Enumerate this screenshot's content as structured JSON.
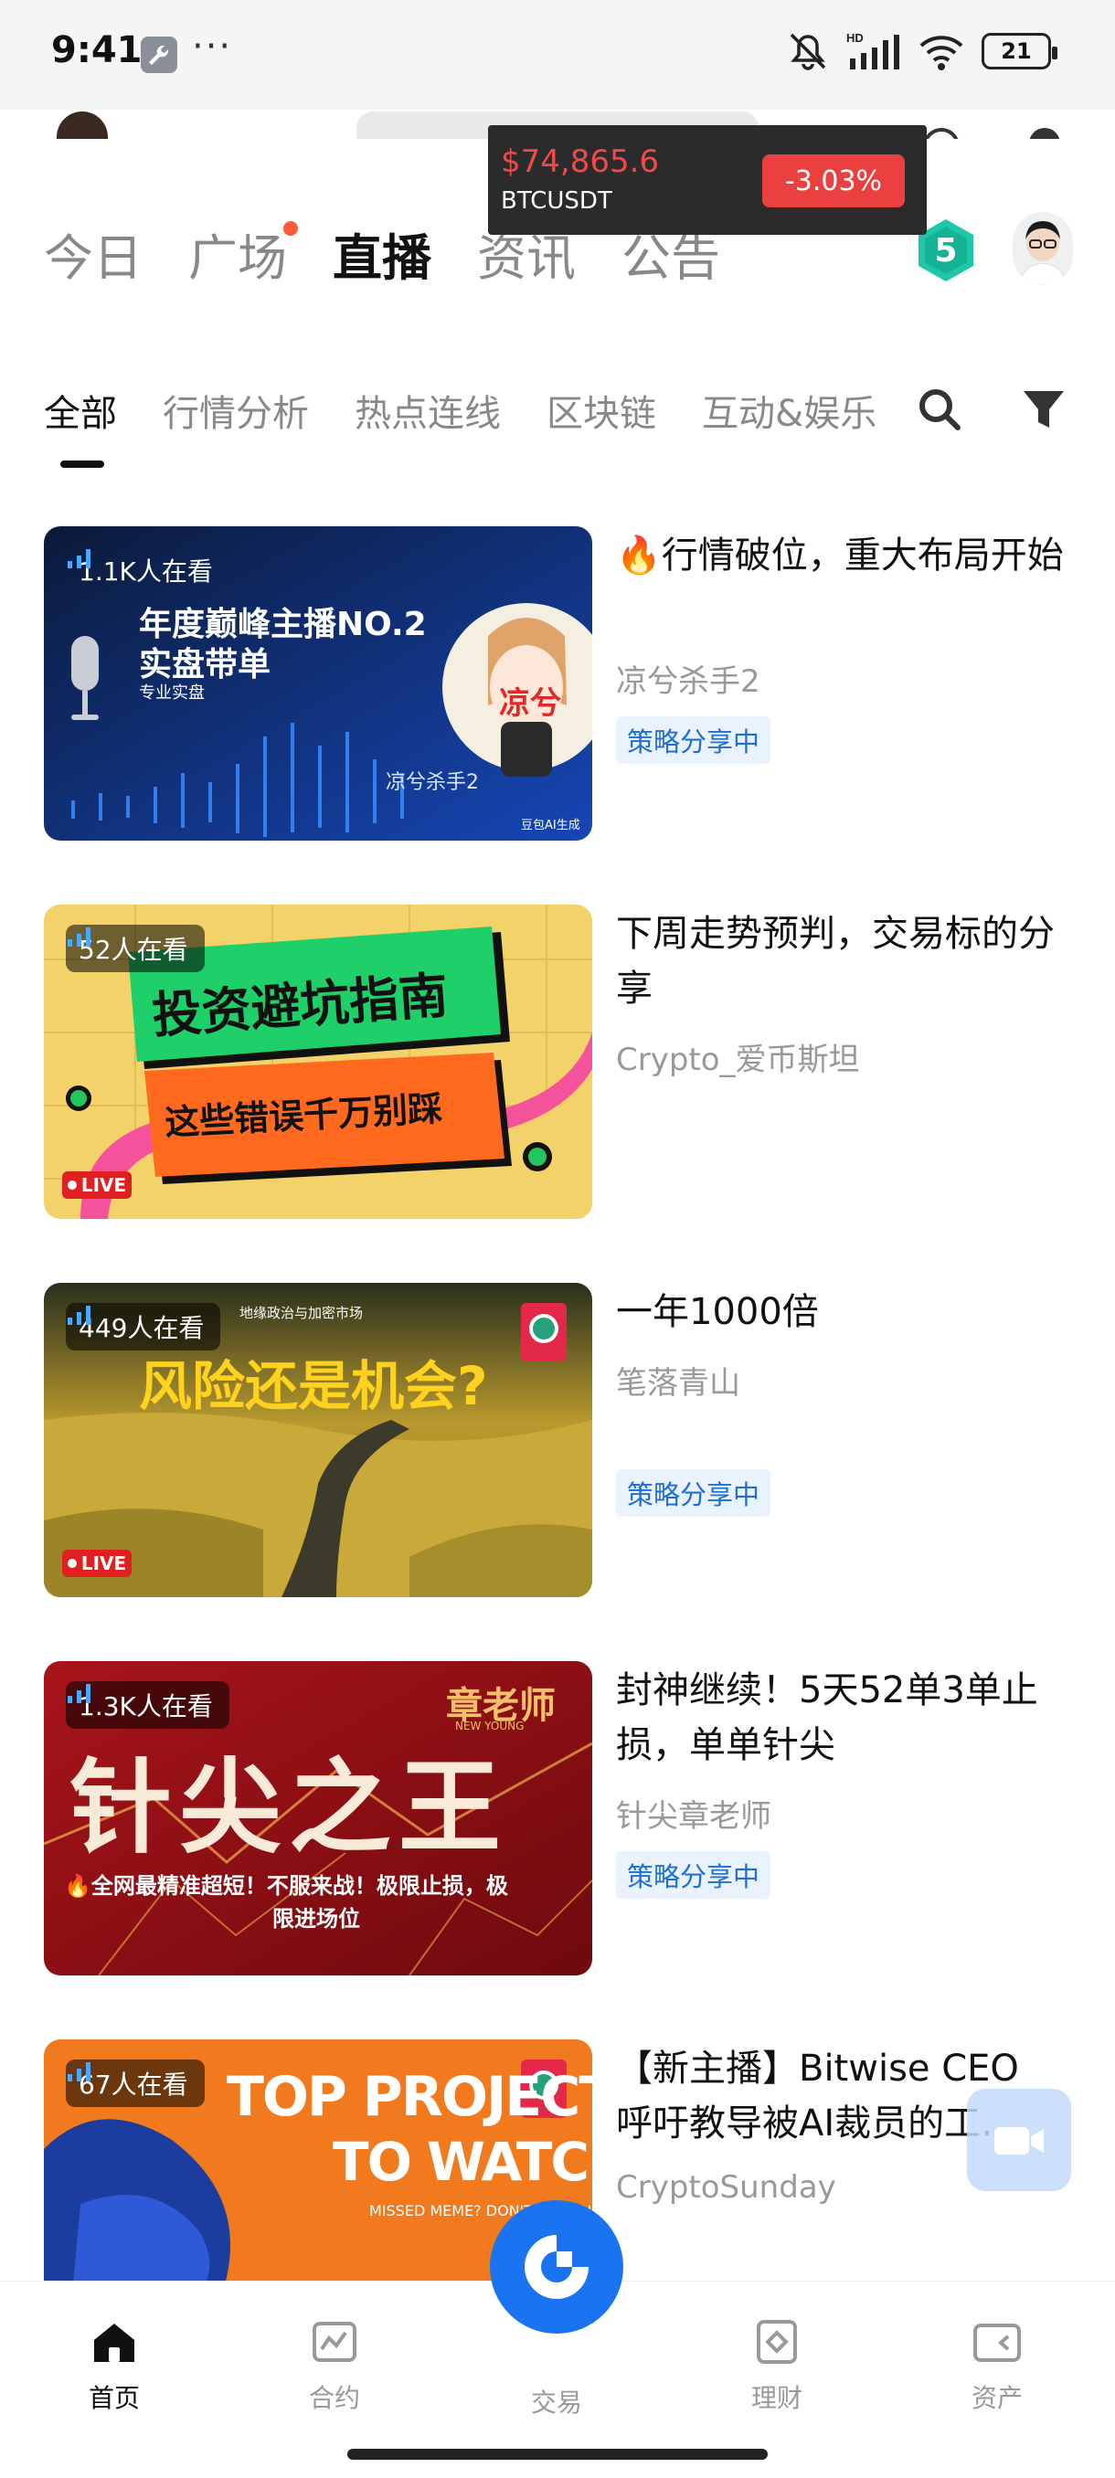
{
  "status_bar": {
    "time": "9:41",
    "network": "HD",
    "battery": "21",
    "icons": [
      "wrench-icon",
      "more-dots-icon",
      "mute-icon",
      "signal-icon",
      "wifi-icon",
      "battery-icon"
    ]
  },
  "ticker": {
    "price": "$74,865.6",
    "pair": "BTCUSDT",
    "change": "-3.03%",
    "price_color": "#f04a4a",
    "change_bg": "#ea4040"
  },
  "main_tabs": [
    {
      "label": "今日",
      "active": false
    },
    {
      "label": "广场",
      "active": false,
      "dot": true
    },
    {
      "label": "直播",
      "active": true
    },
    {
      "label": "资讯",
      "active": false
    },
    {
      "label": "公告",
      "active": false
    }
  ],
  "level_badge": "5",
  "sub_tabs": [
    {
      "label": "全部",
      "active": true
    },
    {
      "label": "行情分析",
      "active": false
    },
    {
      "label": "热点连线",
      "active": false
    },
    {
      "label": "区块链",
      "active": false
    },
    {
      "label": "互动&娱乐",
      "active": false
    }
  ],
  "streams": [
    {
      "viewers": "1.1K人在看",
      "title": "🔥行情破位，重大布局开始",
      "host": "凉兮杀手2",
      "tag": "策略分享中",
      "live": false,
      "thumb_lines": [
        "年度巅峰主播NO.2",
        "实盘带单",
        "专业实盘",
        "凉兮杀手2",
        "豆包AI生成",
        "凉兮"
      ]
    },
    {
      "viewers": "52人在看",
      "title": "下周走势预判，交易标的分享",
      "host": "Crypto_爱币斯坦",
      "tag": "",
      "live": true,
      "thumb_lines": [
        "投资避坑指南",
        "这些错误千万别踩"
      ]
    },
    {
      "viewers": "449人在看",
      "title": "一年1000倍",
      "host": "笔落青山",
      "tag": "策略分享中",
      "live": true,
      "thumb_lines": [
        "地缘政治与加密市场",
        "风险还是机会?"
      ]
    },
    {
      "viewers": "1.3K人在看",
      "title": "封神继续！5天52单3单止损，单单针尖",
      "host": "针尖章老师",
      "tag": "策略分享中",
      "live": false,
      "thumb_lines": [
        "章老师",
        "NEW YOUNG",
        "针尖之王",
        "🔥全网最精准超短！不服来战！极限止损，极",
        "限进场位"
      ]
    },
    {
      "viewers": "67人在看",
      "title": "【新主播】Bitwise CEO呼吁教导被AI裁员的工…",
      "host": "CryptoSunday",
      "tag": "",
      "live": false,
      "thumb_lines": [
        "TOP PROJECTS",
        "TO WATCH",
        "MISSED MEME? DON'T MISS AI"
      ]
    }
  ],
  "bottom_nav": [
    {
      "label": "首页",
      "icon": "home-icon",
      "active": true
    },
    {
      "label": "合约",
      "icon": "contract-chart-icon",
      "active": false
    },
    {
      "label": "交易",
      "icon": "trade-logo-icon",
      "active": false
    },
    {
      "label": "理财",
      "icon": "finance-icon",
      "active": false
    },
    {
      "label": "资产",
      "icon": "wallet-icon",
      "active": false
    }
  ],
  "colors": {
    "accent_blue": "#1a73f0",
    "tag_bg": "#e9f2fd",
    "tag_text": "#1e6fd0",
    "live_red": "#e02020"
  }
}
